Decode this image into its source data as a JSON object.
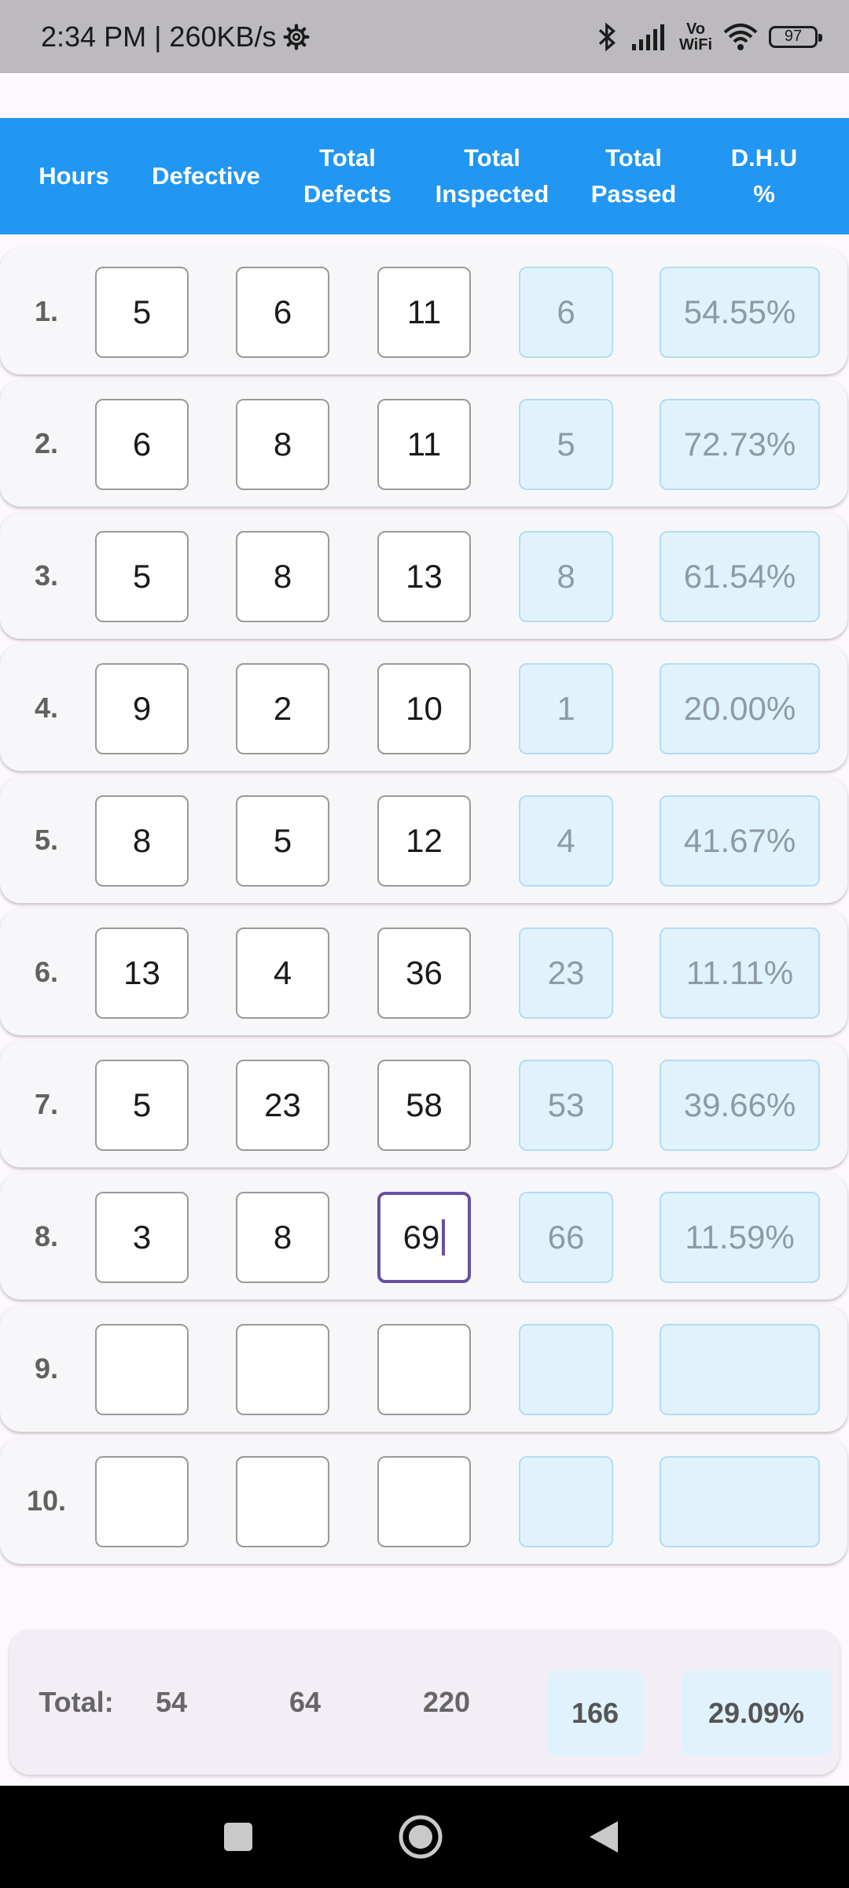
{
  "status": {
    "time_speed": "2:34 PM | 260KB/s",
    "vowifi_top": "Vo",
    "vowifi_bottom": "WiFi",
    "battery": "97"
  },
  "header": {
    "columns": [
      "Hours",
      "Defective",
      "Total\nDefects",
      "Total\nInspected",
      "Total\nPassed",
      "D.H.U %"
    ]
  },
  "rows": [
    {
      "label": "1.",
      "defective": "5",
      "total_defects": "6",
      "total_inspected": "11",
      "total_passed": "6",
      "dhu": "54.55%"
    },
    {
      "label": "2.",
      "defective": "6",
      "total_defects": "8",
      "total_inspected": "11",
      "total_passed": "5",
      "dhu": "72.73%"
    },
    {
      "label": "3.",
      "defective": "5",
      "total_defects": "8",
      "total_inspected": "13",
      "total_passed": "8",
      "dhu": "61.54%"
    },
    {
      "label": "4.",
      "defective": "9",
      "total_defects": "2",
      "total_inspected": "10",
      "total_passed": "1",
      "dhu": "20.00%"
    },
    {
      "label": "5.",
      "defective": "8",
      "total_defects": "5",
      "total_inspected": "12",
      "total_passed": "4",
      "dhu": "41.67%"
    },
    {
      "label": "6.",
      "defective": "13",
      "total_defects": "4",
      "total_inspected": "36",
      "total_passed": "23",
      "dhu": "11.11%"
    },
    {
      "label": "7.",
      "defective": "5",
      "total_defects": "23",
      "total_inspected": "58",
      "total_passed": "53",
      "dhu": "39.66%"
    },
    {
      "label": "8.",
      "defective": "3",
      "total_defects": "8",
      "total_inspected": "69",
      "total_passed": "66",
      "dhu": "11.59%"
    },
    {
      "label": "9.",
      "defective": "",
      "total_defects": "",
      "total_inspected": "",
      "total_passed": "",
      "dhu": ""
    },
    {
      "label": "10.",
      "defective": "",
      "total_defects": "",
      "total_inspected": "",
      "total_passed": "",
      "dhu": ""
    }
  ],
  "totals": {
    "label": "Total:",
    "defective": "54",
    "total_defects": "64",
    "total_inspected": "220",
    "total_passed": "166",
    "dhu": "29.09%"
  },
  "colors": {
    "header_bg": "#2196f3",
    "focus_border": "#6750a4",
    "output_bg": "#e0f3fc"
  }
}
